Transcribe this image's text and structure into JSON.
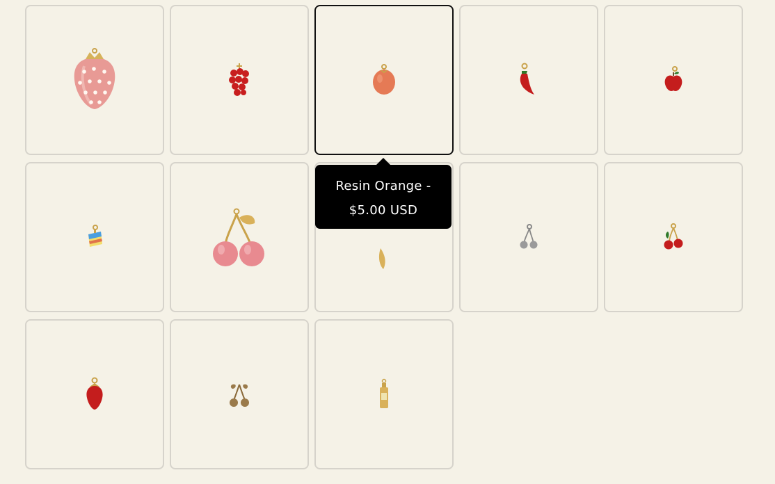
{
  "products": [
    {
      "id": "pink-strawberry",
      "icon": "pink-strawberry-charm-icon"
    },
    {
      "id": "red-grapes",
      "icon": "red-grape-charm-icon"
    },
    {
      "id": "resin-orange",
      "icon": "orange-charm-icon",
      "selected": true
    },
    {
      "id": "chili-pepper",
      "icon": "chili-pepper-charm-icon"
    },
    {
      "id": "red-apple",
      "icon": "apple-charm-icon"
    },
    {
      "id": "cake-slice",
      "icon": "cake-charm-icon"
    },
    {
      "id": "pink-cherries",
      "icon": "pink-cherry-charm-icon"
    },
    {
      "id": "gold-leaf",
      "icon": "gold-leaf-charm-icon"
    },
    {
      "id": "silver-cherries",
      "icon": "silver-cherry-charm-icon"
    },
    {
      "id": "red-cherries",
      "icon": "red-cherry-charm-icon"
    },
    {
      "id": "red-strawberry",
      "icon": "red-strawberry-charm-icon"
    },
    {
      "id": "bronze-cherries",
      "icon": "bronze-cherry-charm-icon"
    },
    {
      "id": "gold-bottle",
      "icon": "gold-bottle-charm-icon"
    }
  ],
  "tooltip": {
    "line1": "Resin Orange -",
    "line2": "$5.00 USD"
  },
  "colors": {
    "background": "#f5f2e7",
    "card_border": "#d6d3cb",
    "selected_border": "#111111",
    "tooltip_bg": "#000000"
  }
}
